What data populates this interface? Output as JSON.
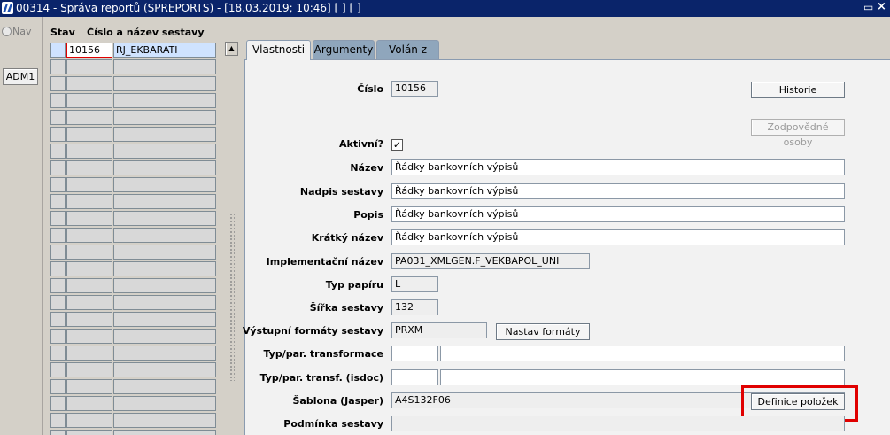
{
  "window": {
    "title": "00314 - Správa reportů (SPREPORTS) - [18.03.2019; 10:46]  [ ]  [ ]",
    "restore_glyph": "▭",
    "close_glyph": "×"
  },
  "nav": {
    "label": "Nav"
  },
  "user_button": "ADM1",
  "list": {
    "header_stav": "Stav",
    "header_name": "Číslo a název sestavy",
    "rows": [
      {
        "number": "10156",
        "name": "RJ_EKBARATI"
      },
      {
        "number": "",
        "name": ""
      },
      {
        "number": "",
        "name": ""
      },
      {
        "number": "",
        "name": ""
      },
      {
        "number": "",
        "name": ""
      },
      {
        "number": "",
        "name": ""
      },
      {
        "number": "",
        "name": ""
      },
      {
        "number": "",
        "name": ""
      },
      {
        "number": "",
        "name": ""
      },
      {
        "number": "",
        "name": ""
      },
      {
        "number": "",
        "name": ""
      },
      {
        "number": "",
        "name": ""
      },
      {
        "number": "",
        "name": ""
      },
      {
        "number": "",
        "name": ""
      },
      {
        "number": "",
        "name": ""
      },
      {
        "number": "",
        "name": ""
      },
      {
        "number": "",
        "name": ""
      },
      {
        "number": "",
        "name": ""
      },
      {
        "number": "",
        "name": ""
      },
      {
        "number": "",
        "name": ""
      },
      {
        "number": "",
        "name": ""
      },
      {
        "number": "",
        "name": ""
      },
      {
        "number": "",
        "name": ""
      },
      {
        "number": "",
        "name": ""
      },
      {
        "number": "",
        "name": ""
      }
    ]
  },
  "tabs": [
    {
      "label": "Vlastnosti",
      "active": true
    },
    {
      "label": "Argumenty",
      "active": false
    },
    {
      "label": "Volán z",
      "active": false
    }
  ],
  "form": {
    "cislo_label": "Číslo",
    "cislo_value": "10156",
    "historie_button": "Historie",
    "zodpovedne_button": "Zodpovědné osoby",
    "aktivni_label": "Aktivní?",
    "aktivni_checked": "✓",
    "nazev_label": "Název",
    "nazev_value": "Řádky bankovních výpisů",
    "nadpis_label": "Nadpis sestavy",
    "nadpis_value": "Řádky bankovních výpisů",
    "popis_label": "Popis",
    "popis_value": "Řádky bankovních výpisů",
    "kratky_label": "Krátký název",
    "kratky_value": "Řádky bankovních výpisů",
    "impl_label": "Implementační název",
    "impl_value": "PA031_XMLGEN.F_VEKBAPOL_UNI",
    "typ_papiru_label": "Typ papíru",
    "typ_papiru_value": "L",
    "sirka_label": "Šířka sestavy",
    "sirka_value": "132",
    "vystupni_label": "Výstupní formáty sestavy",
    "vystupni_value": "PRXM",
    "nastav_button": "Nastav formáty",
    "transformace_label": "Typ/par. transformace",
    "transformace_type": "",
    "transformace_param": "",
    "isdoc_label": "Typ/par. transf. (isdoc)",
    "isdoc_type": "",
    "isdoc_param": "",
    "sablona_label": "Šablona (Jasper)",
    "sablona_value": "A4S132F06",
    "definice_button": "Definice položek",
    "podminka_label": "Podmínka sestavy",
    "podminka_value": ""
  }
}
